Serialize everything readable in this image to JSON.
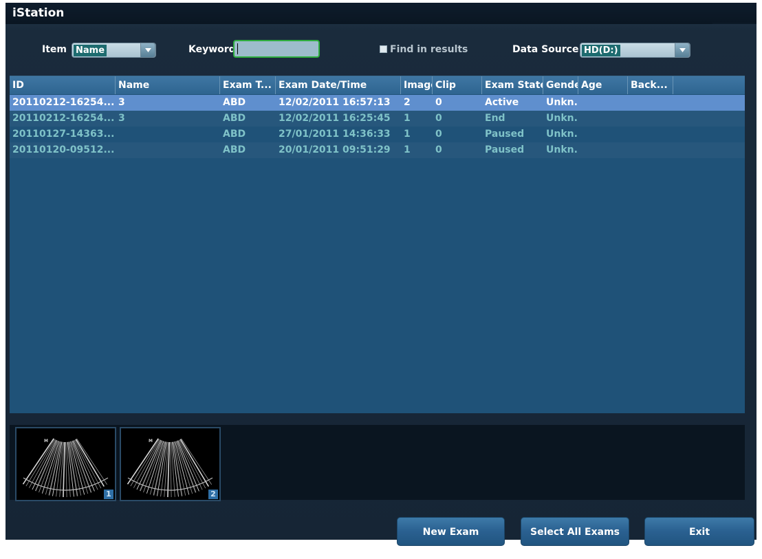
{
  "window": {
    "title": "iStation"
  },
  "search": {
    "item_label": "Item",
    "item_value": "Name",
    "keyword_label": "Keyword",
    "keyword_value": "",
    "find_in_results_label": "Find in results",
    "find_in_results_checked": false,
    "data_source_label": "Data Source",
    "data_source_value": "HD(D:)"
  },
  "table": {
    "columns": [
      "ID",
      "Name",
      "Exam T...",
      "Exam Date/Time",
      "Image",
      "Clip",
      "Exam State",
      "Gender",
      "Age",
      "Back..."
    ],
    "rows": [
      {
        "id": "20110212-16254...",
        "name": "3",
        "exam_type": "ABD",
        "datetime": "12/02/2011 16:57:13",
        "image": "2",
        "clip": "0",
        "state": "Active",
        "gender": "Unkn...",
        "age": "",
        "back": ""
      },
      {
        "id": "20110212-16254...",
        "name": "3",
        "exam_type": "ABD",
        "datetime": "12/02/2011 16:25:45",
        "image": "1",
        "clip": "0",
        "state": "End",
        "gender": "Unkn...",
        "age": "",
        "back": ""
      },
      {
        "id": "20110127-14363...",
        "name": "",
        "exam_type": "ABD",
        "datetime": "27/01/2011 14:36:33",
        "image": "1",
        "clip": "0",
        "state": "Paused",
        "gender": "Unkn...",
        "age": "",
        "back": ""
      },
      {
        "id": "20110120-09512...",
        "name": "",
        "exam_type": "ABD",
        "datetime": "20/01/2011 09:51:29",
        "image": "1",
        "clip": "0",
        "state": "Paused",
        "gender": "Unkn...",
        "age": "",
        "back": ""
      }
    ],
    "selected_row": 0
  },
  "thumbnails": [
    {
      "number": "1",
      "icon": "ultrasound-image"
    },
    {
      "number": "2",
      "icon": "ultrasound-image"
    }
  ],
  "buttons": {
    "new_exam": "New Exam",
    "select_all": "Select All Exams",
    "exit": "Exit"
  },
  "colors": {
    "selected_row": "#5f8fce",
    "row_text": "#7fc2c8",
    "keyword_border": "#2fae3f"
  }
}
